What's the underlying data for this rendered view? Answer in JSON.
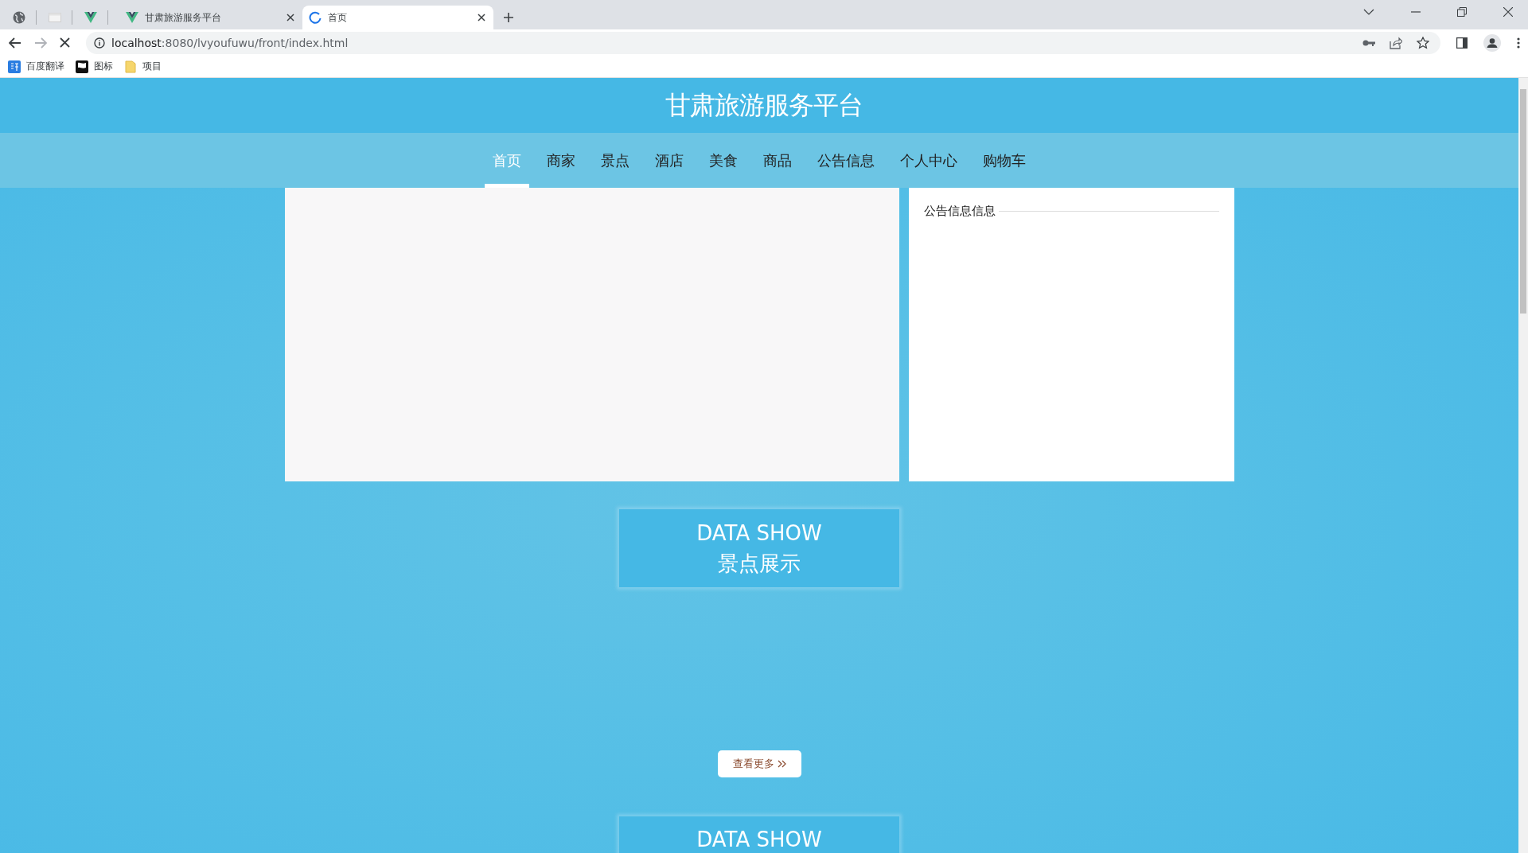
{
  "browser": {
    "tabs": [
      {
        "title": "甘肃旅游服务平台",
        "selected": false,
        "loading": false
      },
      {
        "title": "首页",
        "selected": true,
        "loading": true
      }
    ],
    "address": {
      "host": "localhost",
      "path": ":8080/lvyoufuwu/front/index.html"
    },
    "bookmarks": [
      {
        "label": "百度翻译"
      },
      {
        "label": "图标"
      },
      {
        "label": "项目"
      }
    ]
  },
  "site": {
    "title": "甘肃旅游服务平台",
    "nav": [
      {
        "label": "首页",
        "selected": true
      },
      {
        "label": "商家",
        "selected": false
      },
      {
        "label": "景点",
        "selected": false
      },
      {
        "label": "酒店",
        "selected": false
      },
      {
        "label": "美食",
        "selected": false
      },
      {
        "label": "商品",
        "selected": false
      },
      {
        "label": "公告信息",
        "selected": false
      },
      {
        "label": "个人中心",
        "selected": false
      },
      {
        "label": "购物车",
        "selected": false
      }
    ],
    "notice_panel": {
      "title": "公告信息信息"
    },
    "sections": [
      {
        "heading_en": "DATA SHOW",
        "heading_cn": "景点展示",
        "more": "查看更多"
      },
      {
        "heading_en": "DATA SHOW"
      }
    ]
  }
}
